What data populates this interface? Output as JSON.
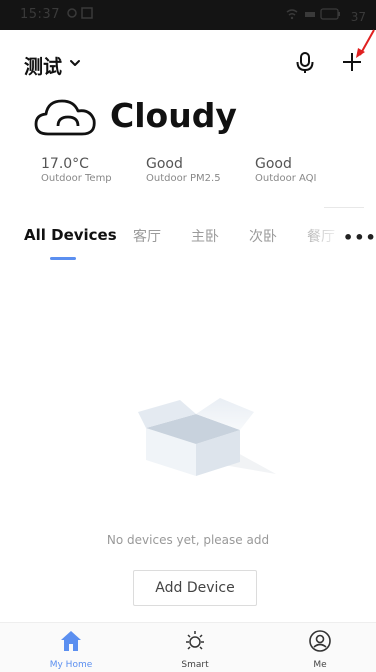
{
  "status_bar": {
    "time": "15:37",
    "battery": "37"
  },
  "header": {
    "home_name": "测试"
  },
  "weather": {
    "condition": "Cloudy",
    "stats": [
      {
        "value": "17.0°C",
        "label": "Outdoor Temp"
      },
      {
        "value": "Good",
        "label": "Outdoor PM2.5"
      },
      {
        "value": "Good",
        "label": "Outdoor AQI"
      }
    ]
  },
  "tabs": [
    "All Devices",
    "客厅",
    "主卧",
    "次卧",
    "餐厅"
  ],
  "empty_state": {
    "message": "No devices yet, please add",
    "button_label": "Add Device"
  },
  "bottom_nav": [
    {
      "label": "My Home",
      "icon": "home-icon",
      "active": true
    },
    {
      "label": "Smart",
      "icon": "sun-icon",
      "active": false
    },
    {
      "label": "Me",
      "icon": "profile-icon",
      "active": false
    }
  ],
  "colors": {
    "accent": "#5b8ff0",
    "annotation_arrow": "#e02020"
  }
}
